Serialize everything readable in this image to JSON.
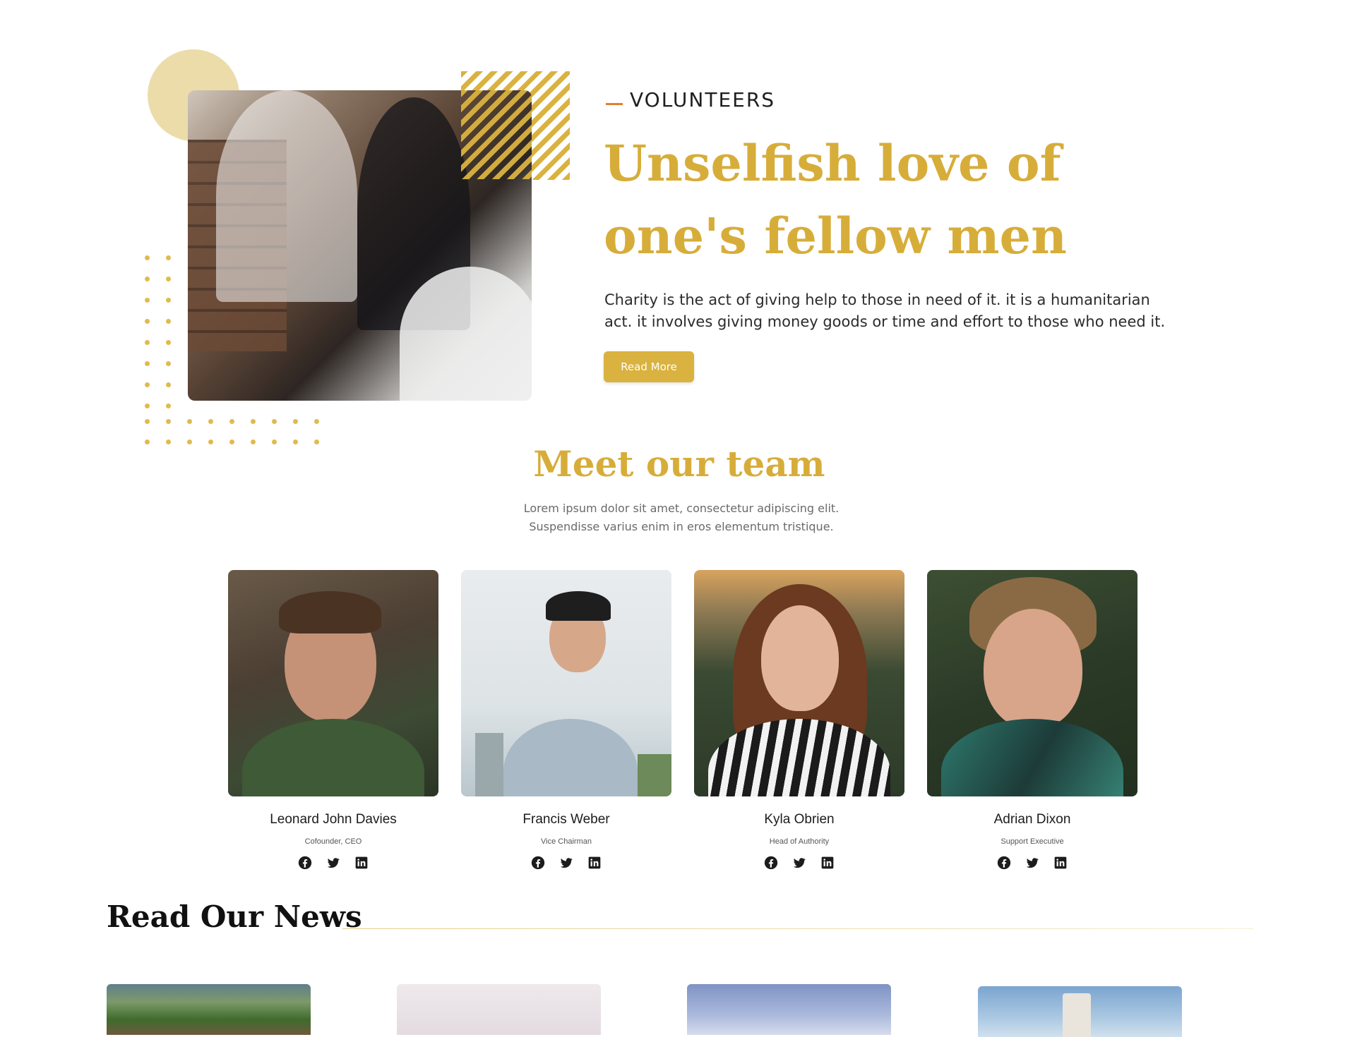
{
  "hero": {
    "eyebrow": "VOLUNTEERS",
    "title": "Unselfish love of one's fellow men",
    "description": "Charity is the act of giving help to those in need of it. it is a humanitarian act. it involves giving money goods or time and effort to those who need it.",
    "button_label": "Read More"
  },
  "team": {
    "title": "Meet our team",
    "subtitle": "Lorem ipsum dolor sit amet, consectetur adipiscing elit. Suspendisse varius enim in eros elementum tristique.",
    "members": [
      {
        "name": "Leonard John Davies",
        "role": "Cofounder, CEO"
      },
      {
        "name": "Francis Weber",
        "role": "Vice Chairman"
      },
      {
        "name": "Kyla Obrien",
        "role": "Head of Authority"
      },
      {
        "name": "Adrian Dixon",
        "role": "Support Executive"
      }
    ],
    "social_icons": [
      "facebook-icon",
      "twitter-icon",
      "linkedin-icon"
    ]
  },
  "news": {
    "title": "Read Our News"
  },
  "colors": {
    "accent": "#d7ad3a",
    "accent_light": "#ecdcaa",
    "dash": "#e0802e"
  }
}
